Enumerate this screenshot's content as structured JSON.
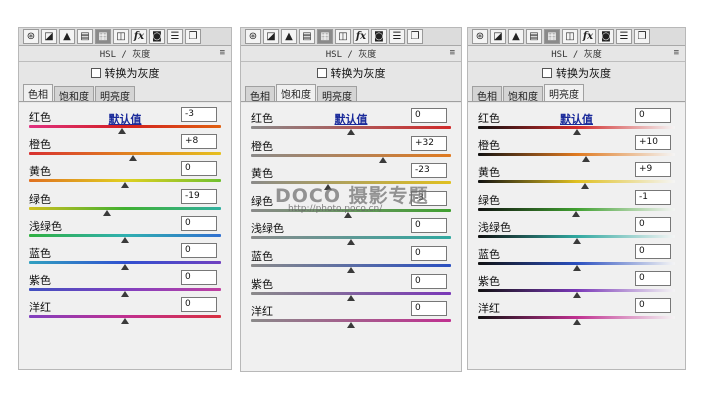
{
  "toolbar_icons": [
    {
      "name": "aperture-icon",
      "glyph": "⊛"
    },
    {
      "name": "tone-curve-icon",
      "glyph": "◪"
    },
    {
      "name": "mountain-icon",
      "glyph": "▲"
    },
    {
      "name": "split-bars-icon",
      "glyph": "▤"
    },
    {
      "name": "hsl-grid-icon",
      "glyph": "▦"
    },
    {
      "name": "split-toning-icon",
      "glyph": "◫"
    },
    {
      "name": "fx-icon",
      "glyph": "fx"
    },
    {
      "name": "camera-icon",
      "glyph": "◙"
    },
    {
      "name": "sliders-icon",
      "glyph": "☰"
    },
    {
      "name": "presets-icon",
      "glyph": "❐"
    }
  ],
  "panels": [
    {
      "header": "HSL / 灰度",
      "convert_label": "转换为灰度",
      "tabs": [
        "色相",
        "饱和度",
        "明亮度"
      ],
      "active_tab": 0,
      "default_label": "默认值",
      "rows": [
        {
          "label": "红色",
          "value": "-3"
        },
        {
          "label": "橙色",
          "value": "+8"
        },
        {
          "label": "黄色",
          "value": "0"
        },
        {
          "label": "绿色",
          "value": "-19"
        },
        {
          "label": "浅绿色",
          "value": "0"
        },
        {
          "label": "蓝色",
          "value": "0"
        },
        {
          "label": "紫色",
          "value": "0"
        },
        {
          "label": "洋红",
          "value": "0"
        }
      ]
    },
    {
      "header": "HSL / 灰度",
      "convert_label": "转换为灰度",
      "tabs": [
        "色相",
        "饱和度",
        "明亮度"
      ],
      "active_tab": 1,
      "default_label": "默认值",
      "rows": [
        {
          "label": "红色",
          "value": "0"
        },
        {
          "label": "橙色",
          "value": "+32"
        },
        {
          "label": "黄色",
          "value": "-23"
        },
        {
          "label": "绿色",
          "value": "-3"
        },
        {
          "label": "浅绿色",
          "value": "0"
        },
        {
          "label": "蓝色",
          "value": "0"
        },
        {
          "label": "紫色",
          "value": "0"
        },
        {
          "label": "洋红",
          "value": "0"
        }
      ]
    },
    {
      "header": "HSL / 灰度",
      "convert_label": "转换为灰度",
      "tabs": [
        "色相",
        "饱和度",
        "明亮度"
      ],
      "active_tab": 2,
      "default_label": "默认值",
      "rows": [
        {
          "label": "红色",
          "value": "0"
        },
        {
          "label": "橙色",
          "value": "+10"
        },
        {
          "label": "黄色",
          "value": "+9"
        },
        {
          "label": "绿色",
          "value": "-1"
        },
        {
          "label": "浅绿色",
          "value": "0"
        },
        {
          "label": "蓝色",
          "value": "0"
        },
        {
          "label": "紫色",
          "value": "0"
        },
        {
          "label": "洋红",
          "value": "0"
        }
      ]
    }
  ],
  "menu_glyph": "≡",
  "watermark": {
    "main": "DOCO 摄影专题",
    "url": "http://photo.poco.cn/"
  }
}
